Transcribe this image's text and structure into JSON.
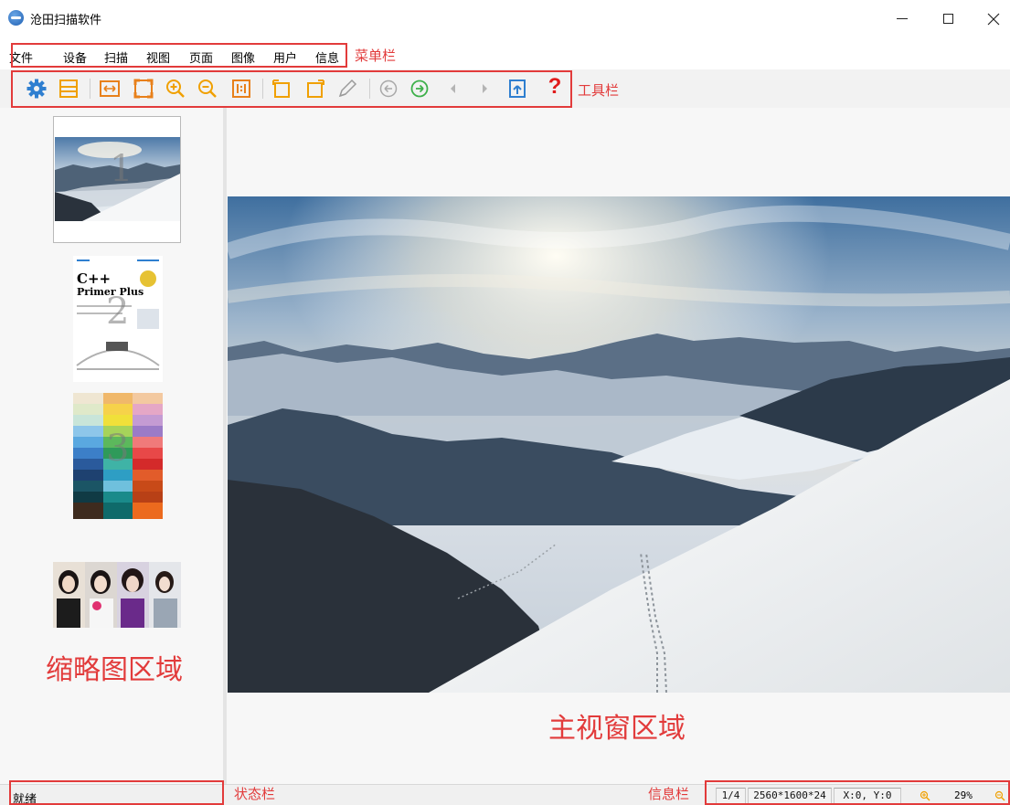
{
  "window": {
    "title": "沧田扫描软件",
    "minimize_label": "–",
    "maximize_label": "□",
    "close_label": "✕"
  },
  "menu": {
    "items": [
      "文件",
      "设备",
      "扫描",
      "视图",
      "页面",
      "图像",
      "用户",
      "信息"
    ]
  },
  "toolbar": {
    "icons": [
      "settings-icon",
      "scan-list-icon",
      "fit-width-icon",
      "fit-page-icon",
      "zoom-in-icon",
      "zoom-out-icon",
      "actual-size-icon",
      "rotate-left-icon",
      "rotate-right-icon",
      "pencil-icon",
      "previous-icon",
      "next-icon",
      "caret-left-icon",
      "caret-right-icon",
      "export-icon",
      "help-icon"
    ],
    "help_label": "?"
  },
  "thumbnails": [
    {
      "page": "1",
      "selected": true
    },
    {
      "page": "2",
      "selected": false,
      "book_title": "C++",
      "book_subtitle": "Primer Plus"
    },
    {
      "page": "3",
      "selected": false
    },
    {
      "page": "",
      "selected": false
    }
  ],
  "annotations": {
    "menubar": "菜单栏",
    "toolbar": "工具栏",
    "thumbnail_area": "缩略图区域",
    "main_area": "主视窗区域",
    "statusbar": "状态栏",
    "infobar": "信息栏"
  },
  "status": {
    "text": "就绪"
  },
  "info": {
    "page": "1/4",
    "dimensions": "2560*1600*24",
    "coords": "X:0, Y:0",
    "zoom": "29%"
  },
  "colors": {
    "annotation_red": "#e23b3b",
    "icon_blue": "#2f7fd0",
    "icon_orange": "#f0a000",
    "icon_green": "#3db04a",
    "help_red": "#e01b1b"
  }
}
